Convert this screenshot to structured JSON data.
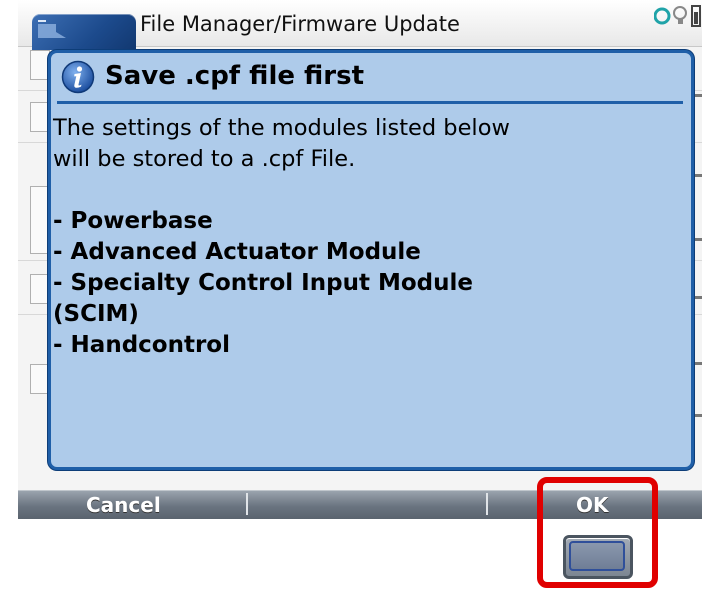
{
  "window": {
    "title": "File Manager/Firmware Update"
  },
  "dialog": {
    "title": "Save .cpf file first",
    "icon": "info-icon",
    "message_lines": [
      "The settings of the modules listed below",
      "will be stored to a .cpf File."
    ],
    "modules": [
      "- Powerbase",
      "- Advanced Actuator Module",
      "- Specialty Control Input Module",
      "(SCIM)",
      "- Handcontrol"
    ]
  },
  "softkeys": {
    "left_label": "Cancel",
    "right_label": "OK"
  },
  "colors": {
    "dialog_bg": "#aecbea",
    "dialog_border": "#1f5fa8",
    "softkey_bar": "#6a7480",
    "highlight": "#e00000"
  }
}
